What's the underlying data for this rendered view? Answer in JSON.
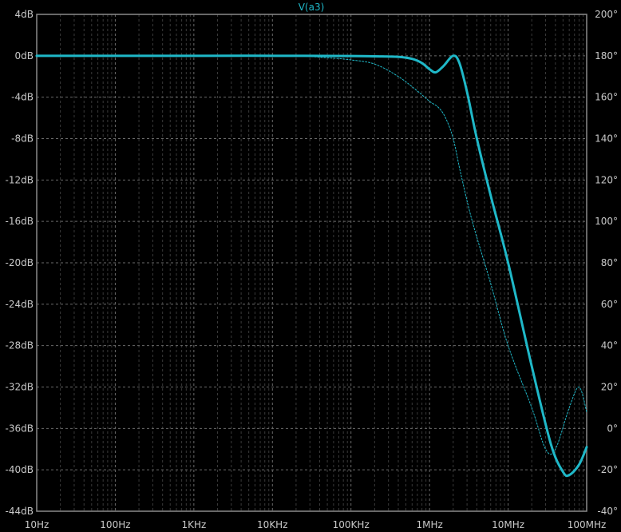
{
  "chart_data": {
    "type": "line",
    "title": "V(a3)",
    "x_scale": "log",
    "xlim": [
      10,
      100000000
    ],
    "x_ticks": [
      {
        "value": 10,
        "label": "10Hz"
      },
      {
        "value": 100,
        "label": "100Hz"
      },
      {
        "value": 1000,
        "label": "1KHz"
      },
      {
        "value": 10000,
        "label": "10KHz"
      },
      {
        "value": 100000,
        "label": "100KHz"
      },
      {
        "value": 1000000,
        "label": "1MHz"
      },
      {
        "value": 10000000,
        "label": "10MHz"
      },
      {
        "value": 100000000,
        "label": "100MHz"
      }
    ],
    "y_left": {
      "lim": [
        -44,
        4
      ],
      "ticks": [
        {
          "value": 4,
          "label": "4dB"
        },
        {
          "value": 0,
          "label": "0dB"
        },
        {
          "value": -4,
          "label": "-4dB"
        },
        {
          "value": -8,
          "label": "-8dB"
        },
        {
          "value": -12,
          "label": "-12dB"
        },
        {
          "value": -16,
          "label": "-16dB"
        },
        {
          "value": -20,
          "label": "-20dB"
        },
        {
          "value": -24,
          "label": "-24dB"
        },
        {
          "value": -28,
          "label": "-28dB"
        },
        {
          "value": -32,
          "label": "-32dB"
        },
        {
          "value": -36,
          "label": "-36dB"
        },
        {
          "value": -40,
          "label": "-40dB"
        },
        {
          "value": -44,
          "label": "-44dB"
        }
      ]
    },
    "y_right": {
      "lim": [
        -40,
        200
      ],
      "ticks": [
        {
          "value": 200,
          "label": "200°"
        },
        {
          "value": 180,
          "label": "180°"
        },
        {
          "value": 160,
          "label": "160°"
        },
        {
          "value": 140,
          "label": "140°"
        },
        {
          "value": 120,
          "label": "120°"
        },
        {
          "value": 100,
          "label": "100°"
        },
        {
          "value": 80,
          "label": "80°"
        },
        {
          "value": 60,
          "label": "60°"
        },
        {
          "value": 40,
          "label": "40°"
        },
        {
          "value": 20,
          "label": "20°"
        },
        {
          "value": 0,
          "label": "0°"
        },
        {
          "value": -20,
          "label": "-20°"
        },
        {
          "value": -40,
          "label": "-40°"
        }
      ]
    },
    "grid": true,
    "series": [
      {
        "axis": "left",
        "style": "solid",
        "color": "#1fb8c8",
        "points": [
          [
            10,
            0
          ],
          [
            100,
            0
          ],
          [
            1000,
            0
          ],
          [
            10000,
            0
          ],
          [
            100000,
            -0.02
          ],
          [
            200000,
            -0.05
          ],
          [
            400000,
            -0.1
          ],
          [
            600000,
            -0.3
          ],
          [
            800000,
            -0.7
          ],
          [
            1000000,
            -1.3
          ],
          [
            1200000,
            -1.6
          ],
          [
            1500000,
            -1.0
          ],
          [
            2000000,
            0.0
          ],
          [
            2400000,
            -0.7
          ],
          [
            3000000,
            -3.5
          ],
          [
            4000000,
            -8.0
          ],
          [
            6000000,
            -13.5
          ],
          [
            10000000,
            -20.0
          ],
          [
            20000000,
            -30.0
          ],
          [
            35000000,
            -37.5
          ],
          [
            50000000,
            -40.2
          ],
          [
            60000000,
            -40.5
          ],
          [
            80000000,
            -39.5
          ],
          [
            100000000,
            -37.8
          ]
        ]
      },
      {
        "axis": "right",
        "style": "dashed",
        "color": "#1fb8c8",
        "points": [
          [
            10,
            180
          ],
          [
            10000,
            180
          ],
          [
            50000,
            179
          ],
          [
            100000,
            178
          ],
          [
            200000,
            176
          ],
          [
            400000,
            170
          ],
          [
            700000,
            163
          ],
          [
            1000000,
            158
          ],
          [
            1300000,
            155
          ],
          [
            1600000,
            150
          ],
          [
            2000000,
            140
          ],
          [
            2500000,
            123
          ],
          [
            3500000,
            100
          ],
          [
            6000000,
            70
          ],
          [
            10000000,
            40
          ],
          [
            20000000,
            10
          ],
          [
            30000000,
            -10
          ],
          [
            40000000,
            -10
          ],
          [
            60000000,
            10
          ],
          [
            80000000,
            20
          ],
          [
            100000000,
            8
          ]
        ]
      }
    ]
  }
}
